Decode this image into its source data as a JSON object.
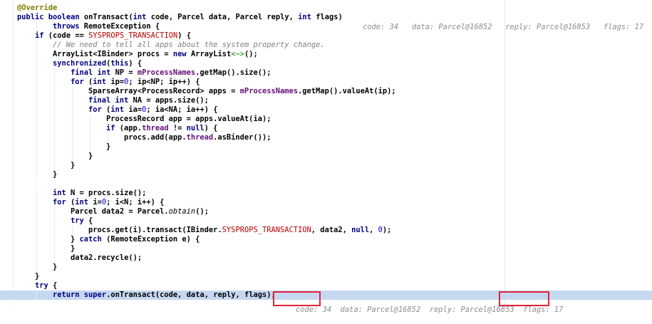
{
  "lines": [
    {
      "seg": [
        [
          "ann",
          "@Override"
        ]
      ],
      "indent": 0
    },
    {
      "seg": [
        [
          "kw",
          "public boolean "
        ],
        [
          "",
          "onTransact("
        ],
        [
          "kw",
          "int "
        ],
        [
          "",
          "code, Parcel data, Parcel reply, "
        ],
        [
          "kw",
          "int "
        ],
        [
          "",
          "flags)"
        ]
      ],
      "indent": 0
    },
    {
      "seg": [
        [
          "kw",
          "throws "
        ],
        [
          "",
          "RemoteException {"
        ]
      ],
      "indent": 2
    },
    {
      "seg": [
        [
          "kw",
          "if "
        ],
        [
          "",
          "(code == "
        ],
        [
          "const",
          "SYSPROPS_TRANSACTION"
        ],
        [
          "",
          ") {"
        ]
      ],
      "indent": 1
    },
    {
      "seg": [
        [
          "cmt",
          "// We need to tell all apps about the system property change."
        ]
      ],
      "indent": 2
    },
    {
      "seg": [
        [
          "",
          "ArrayList<IBinder> procs = "
        ],
        [
          "kw",
          "new "
        ],
        [
          "",
          "ArrayList"
        ],
        [
          "diamond",
          "<~>"
        ],
        [
          "",
          "();"
        ]
      ],
      "indent": 2
    },
    {
      "seg": [
        [
          "kw",
          "synchronized"
        ],
        [
          "",
          "("
        ],
        [
          "kw",
          "this"
        ],
        [
          "",
          ") {"
        ]
      ],
      "indent": 2
    },
    {
      "seg": [
        [
          "kw",
          "final int "
        ],
        [
          "",
          "NP = "
        ],
        [
          "field",
          "mProcessNames"
        ],
        [
          "",
          ".getMap().size();"
        ]
      ],
      "indent": 3
    },
    {
      "seg": [
        [
          "kw",
          "for "
        ],
        [
          "",
          "("
        ],
        [
          "kw",
          "int "
        ],
        [
          "",
          "ip="
        ],
        [
          "num",
          "0"
        ],
        [
          "",
          "; ip<NP; ip++) {"
        ]
      ],
      "indent": 3
    },
    {
      "seg": [
        [
          "",
          "SparseArray<ProcessRecord> apps = "
        ],
        [
          "field",
          "mProcessNames"
        ],
        [
          "",
          ".getMap().valueAt(ip);"
        ]
      ],
      "indent": 4
    },
    {
      "seg": [
        [
          "kw",
          "final int "
        ],
        [
          "",
          "NA = apps.size();"
        ]
      ],
      "indent": 4
    },
    {
      "seg": [
        [
          "kw",
          "for "
        ],
        [
          "",
          "("
        ],
        [
          "kw",
          "int "
        ],
        [
          "",
          "ia="
        ],
        [
          "num",
          "0"
        ],
        [
          "",
          "; ia<NA; ia++) {"
        ]
      ],
      "indent": 4
    },
    {
      "seg": [
        [
          "",
          "ProcessRecord app = apps.valueAt(ia);"
        ]
      ],
      "indent": 5
    },
    {
      "seg": [
        [
          "kw",
          "if "
        ],
        [
          "",
          "(app."
        ],
        [
          "field",
          "thread "
        ],
        [
          "",
          "!= "
        ],
        [
          "kw",
          "null"
        ],
        [
          "",
          ") {"
        ]
      ],
      "indent": 5
    },
    {
      "seg": [
        [
          "",
          "procs.add(app."
        ],
        [
          "field",
          "thread"
        ],
        [
          "",
          ".asBinder());"
        ]
      ],
      "indent": 6
    },
    {
      "seg": [
        [
          "",
          "}"
        ]
      ],
      "indent": 5
    },
    {
      "seg": [
        [
          "",
          "}"
        ]
      ],
      "indent": 4
    },
    {
      "seg": [
        [
          "",
          "}"
        ]
      ],
      "indent": 3
    },
    {
      "seg": [
        [
          "",
          "}"
        ]
      ],
      "indent": 2
    },
    {
      "seg": [],
      "indent": 0
    },
    {
      "seg": [
        [
          "kw",
          "int "
        ],
        [
          "",
          "N = procs.size();"
        ]
      ],
      "indent": 2
    },
    {
      "seg": [
        [
          "kw",
          "for "
        ],
        [
          "",
          "("
        ],
        [
          "kw",
          "int "
        ],
        [
          "",
          "i="
        ],
        [
          "num",
          "0"
        ],
        [
          "",
          "; i<N; i++) {"
        ]
      ],
      "indent": 2
    },
    {
      "seg": [
        [
          "",
          "Parcel data2 = Parcel."
        ],
        [
          "ital",
          "obtain"
        ],
        [
          "",
          "();"
        ]
      ],
      "indent": 3
    },
    {
      "seg": [
        [
          "kw",
          "try "
        ],
        [
          "",
          "{"
        ]
      ],
      "indent": 3
    },
    {
      "seg": [
        [
          "",
          "procs.get(i).transact(IBinder."
        ],
        [
          "const",
          "SYSPROPS_TRANSACTION"
        ],
        [
          "",
          ", data2, "
        ],
        [
          "kw",
          "null"
        ],
        [
          "",
          ", "
        ],
        [
          "num",
          "0"
        ],
        [
          "",
          ");"
        ]
      ],
      "indent": 4
    },
    {
      "seg": [
        [
          "",
          "} "
        ],
        [
          "kw",
          "catch "
        ],
        [
          "",
          "(RemoteException e) {"
        ]
      ],
      "indent": 3
    },
    {
      "seg": [
        [
          "",
          "}"
        ]
      ],
      "indent": 3
    },
    {
      "seg": [
        [
          "",
          "data2.recycle();"
        ]
      ],
      "indent": 3
    },
    {
      "seg": [
        [
          "",
          "}"
        ]
      ],
      "indent": 2
    },
    {
      "seg": [
        [
          "",
          "}"
        ]
      ],
      "indent": 1
    },
    {
      "seg": [
        [
          "kw",
          "try "
        ],
        [
          "",
          "{"
        ]
      ],
      "indent": 1
    },
    {
      "seg": [
        [
          "kw",
          "return super"
        ],
        [
          "",
          ".onTransact(code, data, reply, flags);"
        ]
      ],
      "indent": 2,
      "highlight": true
    }
  ],
  "debug_hints": {
    "line2": {
      "code": "code: 34",
      "data": "data: Parcel@16852",
      "reply": "reply: Parcel@16853",
      "flags": "flags: 17"
    },
    "return_line": {
      "code": "code: 34",
      "data": "data: Parcel@16852",
      "reply": "reply: Parcel@16853",
      "flags": "flags: 17"
    }
  },
  "colors": {
    "keyword": "#000080",
    "annotation": "#808000",
    "constant": "#b80000",
    "field": "#660e7a",
    "number": "#0000ff",
    "comment": "#808080",
    "execution_highlight": "#c6d7f0",
    "annotation_box": "#e0243c"
  }
}
